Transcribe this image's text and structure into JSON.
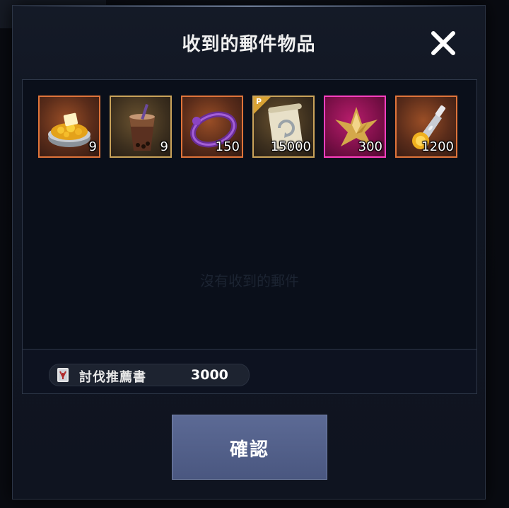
{
  "dialog": {
    "title": "收到的郵件物品",
    "empty_message": "沒有收到的郵件",
    "items": [
      {
        "icon": "mango-shaved-ice-icon",
        "quantity": "9",
        "rarity": "orange"
      },
      {
        "icon": "bubble-tea-icon",
        "quantity": "9",
        "rarity": "gold"
      },
      {
        "icon": "purple-bracelet-icon",
        "quantity": "150",
        "rarity": "orange"
      },
      {
        "icon": "scroll-icon",
        "quantity": "15000",
        "rarity": "gold",
        "badge": "P"
      },
      {
        "icon": "golden-crystal-icon",
        "quantity": "300",
        "rarity": "pink"
      },
      {
        "icon": "elixir-flask-icon",
        "quantity": "1200",
        "rarity": "orange"
      }
    ],
    "cost": {
      "icon": "subjugation-book-icon",
      "label": "討伐推薦書",
      "value": "3000"
    },
    "confirm_label": "確認"
  },
  "colors": {
    "orange_frame": "#e0743a",
    "gold_frame": "#caa35a",
    "pink_frame": "#ff3fc0",
    "button": "#52608a"
  }
}
